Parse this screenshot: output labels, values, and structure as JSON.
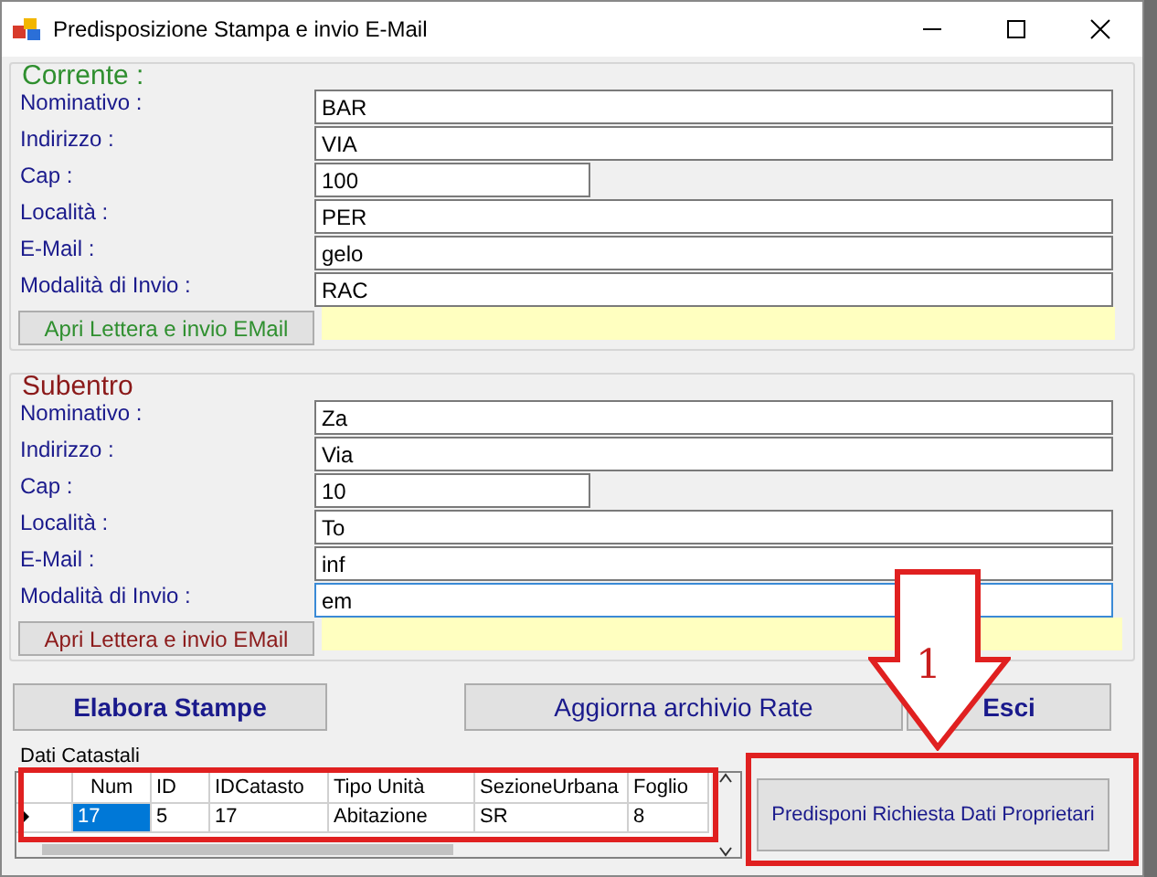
{
  "window": {
    "title": "Predisposizione Stampa e invio E-Mail"
  },
  "sections": [
    {
      "title": "Corrente :",
      "color": "#2f8f2f",
      "button": "Apri Lettera e invio EMail",
      "fields": [
        {
          "label": "Nominativo :",
          "value": "BAR",
          "focused": false
        },
        {
          "label": "Indirizzo :",
          "value": "VIA",
          "focused": false
        },
        {
          "label": "Cap :",
          "value": "100",
          "focused": false
        },
        {
          "label": "Località :",
          "value": "PER",
          "focused": false
        },
        {
          "label": "E-Mail  :",
          "value": "gelo",
          "focused": false
        },
        {
          "label": "Modalità di Invio :",
          "value": "RAC",
          "focused": false
        }
      ]
    },
    {
      "title": "Subentro",
      "color": "#8b1a1a",
      "button": "Apri Lettera e invio EMail",
      "fields": [
        {
          "label": "Nominativo  :",
          "value": "Za",
          "focused": false
        },
        {
          "label": "Indirizzo :",
          "value": "Via",
          "focused": false
        },
        {
          "label": "Cap :",
          "value": "10",
          "focused": false
        },
        {
          "label": "Località :",
          "value": "To",
          "focused": false
        },
        {
          "label": "E-Mail  :",
          "value": "inf",
          "focused": false
        },
        {
          "label": "Modalità di Invio :",
          "value": "em",
          "focused": true
        }
      ]
    }
  ],
  "buttons": [
    {
      "label": "Elabora Stampe",
      "bold": true
    },
    {
      "label": "Aggiorna  archivio Rate",
      "bold": false
    },
    {
      "label": "Esci",
      "bold": true
    }
  ],
  "grid": {
    "title": "Dati Catastali",
    "columns": [
      "Num",
      "ID",
      "IDCatasto",
      "Tipo Unità",
      "SezioneUrbana",
      "Foglio"
    ],
    "rows": [
      {
        "current": true,
        "cells": [
          {
            "text": "17",
            "selected": true
          },
          {
            "text": "5",
            "selected": false
          },
          {
            "text": "17",
            "selected": false
          },
          {
            "text": "Abitazione",
            "selected": false
          },
          {
            "text": "SR",
            "selected": false
          },
          {
            "text": "8",
            "selected": false
          }
        ]
      }
    ]
  },
  "action_button": "Predisponi Richiesta Dati Proprietari",
  "annotation": {
    "label": "1"
  }
}
